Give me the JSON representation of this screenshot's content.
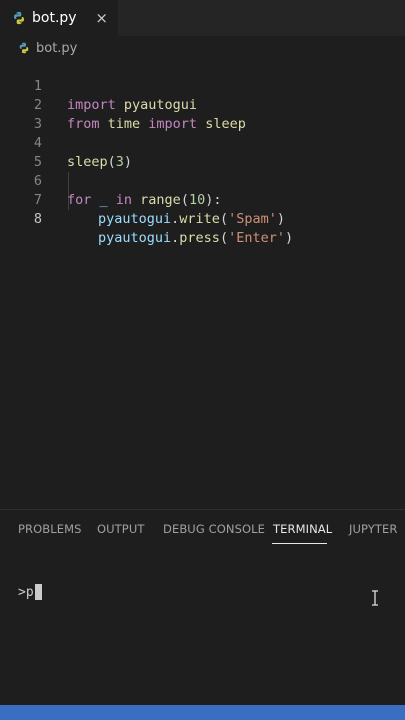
{
  "editor_tab": {
    "label": "bot.py",
    "close": "×"
  },
  "breadcrumb": {
    "file": "bot.py"
  },
  "code": {
    "lines": [
      {
        "num": "1"
      },
      {
        "num": "2"
      },
      {
        "num": "3"
      },
      {
        "num": "4"
      },
      {
        "num": "5"
      },
      {
        "num": "6"
      },
      {
        "num": "7"
      },
      {
        "num": "8"
      }
    ],
    "l1": {
      "kw": "import",
      "mod": " pyautogui"
    },
    "l2": {
      "kw1": "from",
      "mod1": " time ",
      "kw2": "import",
      "fn": " sleep"
    },
    "l4": {
      "fn": "sleep",
      "p1": "(",
      "num": "3",
      "p2": ")"
    },
    "l6": {
      "kw1": "for",
      "var": " _ ",
      "kw2": "in",
      "fn": " range",
      "p1": "(",
      "num": "10",
      "p2": "):"
    },
    "l7": {
      "obj": "pyautogui",
      "dot": ".",
      "fn": "write",
      "p1": "(",
      "str": "'Spam'",
      "p2": ")"
    },
    "l8": {
      "obj": "pyautogui",
      "dot": ".",
      "fn": "press",
      "p1": "(",
      "str": "'Enter'",
      "p2": ")"
    }
  },
  "panel": {
    "tabs": [
      {
        "label": "PROBLEMS"
      },
      {
        "label": "OUTPUT"
      },
      {
        "label": "DEBUG CONSOLE"
      },
      {
        "label": "TERMINAL"
      },
      {
        "label": "JUPYTER"
      }
    ],
    "active_tab": "TERMINAL"
  },
  "terminal": {
    "input": ">p"
  },
  "colors": {
    "background": "#1e1e1e",
    "keyword": "#c586c0",
    "function": "#dcdcaa",
    "variable": "#9cdcfe",
    "number": "#b5cea8",
    "string": "#ce9178",
    "statusbar": "#3a6ec1"
  },
  "icons": {
    "file": "python-file-icon",
    "pointer": "text-cursor-icon"
  }
}
